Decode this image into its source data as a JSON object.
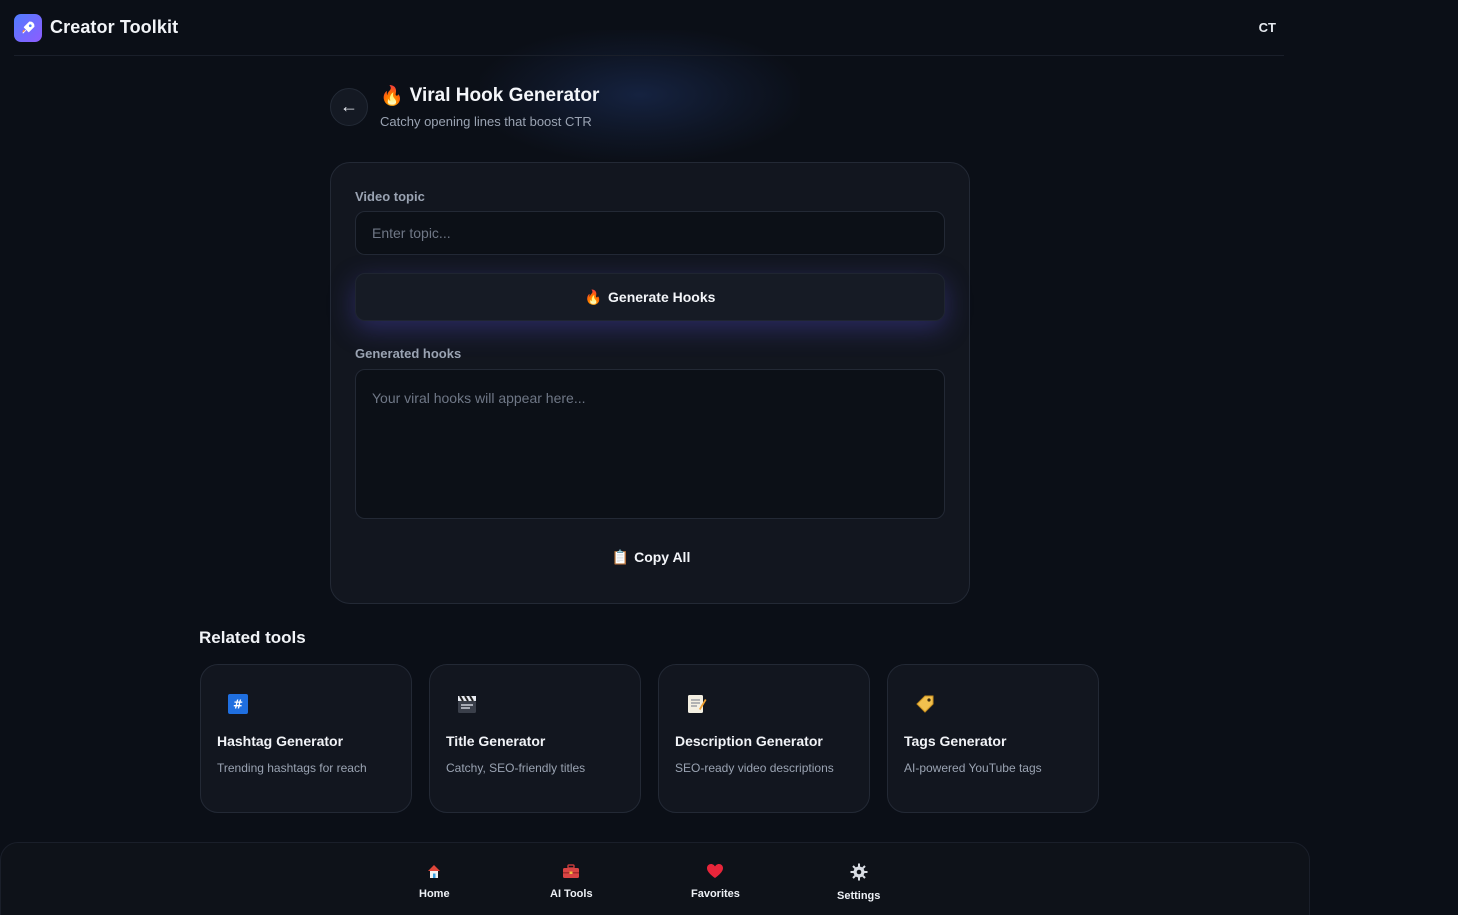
{
  "app": {
    "title": "Creator Toolkit",
    "avatar_initials": "CT"
  },
  "tool": {
    "emoji": "🔥",
    "title": "Viral Hook Generator",
    "subtitle": "Catchy opening lines that boost CTR"
  },
  "form": {
    "topic_label": "Video topic",
    "topic_placeholder": "Enter topic...",
    "topic_value": "",
    "generate_emoji": "🔥",
    "generate_label": "Generate Hooks",
    "output_label": "Generated hooks",
    "output_placeholder": "Your viral hooks will appear here...",
    "copy_emoji": "📋",
    "copy_label": "Copy All"
  },
  "related": {
    "title": "Related tools",
    "items": [
      {
        "name": "Hashtag Generator",
        "desc": "Trending hashtags for reach",
        "icon": "hashtag-icon"
      },
      {
        "name": "Title Generator",
        "desc": "Catchy, SEO-friendly titles",
        "icon": "clapperboard-icon"
      },
      {
        "name": "Description Generator",
        "desc": "SEO-ready video descriptions",
        "icon": "memo-icon"
      },
      {
        "name": "Tags Generator",
        "desc": "AI-powered YouTube tags",
        "icon": "tag-icon"
      }
    ]
  },
  "nav": {
    "items": [
      {
        "label": "Home",
        "icon": "home-icon"
      },
      {
        "label": "AI Tools",
        "icon": "toolbox-icon"
      },
      {
        "label": "Favorites",
        "icon": "heart-icon"
      },
      {
        "label": "Settings",
        "icon": "gear-icon"
      }
    ]
  },
  "colors": {
    "accent": "#4f7cff",
    "accent2": "#8f5cff",
    "background": "#0b0f17",
    "card": "#12161f"
  }
}
